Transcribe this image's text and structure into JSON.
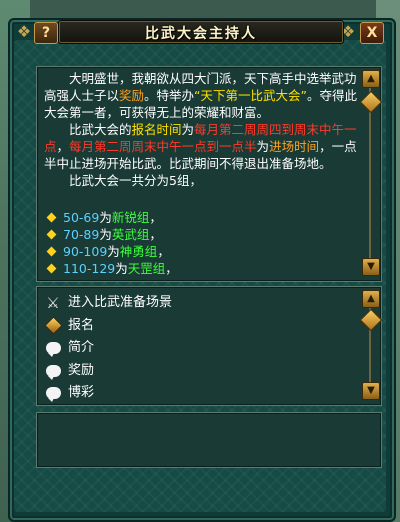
{
  "window": {
    "title": "比武大会主持人",
    "help_label": "?",
    "close_label": "X"
  },
  "dialog": {
    "p1_a": "大明盛世，我朝欲从四大门派，天下高手中选举武功高强人士子以",
    "p1_b": "奖励",
    "p1_c": "。特举办",
    "p1_d": "“天下第一比武大会”",
    "p1_e": "。夺得此大会第一者，可获得无上的荣耀和财富。",
    "p2_a": "比武大会的",
    "p2_b": "报名时间",
    "p2_c": "为",
    "p2_d": "每月第二周周四到周末中午一点",
    "p2_e": "，",
    "p2_f": "每月第二周周末中午一点到一点半",
    "p2_g": "为",
    "p2_h": "进场时间",
    "p2_i": "，一点半中止进场开始比武。比武期间不得退出准备场地。",
    "p3": "比武大会一共分为5组，",
    "groups": [
      {
        "range": "50-69",
        "connector": "为",
        "name": "新锐组",
        "suffix": "，"
      },
      {
        "range": "70-89",
        "connector": "为",
        "name": "英武组",
        "suffix": "，"
      },
      {
        "range": "90-109",
        "connector": "为",
        "name": "神勇组",
        "suffix": "，"
      },
      {
        "range": "110-129",
        "connector": "为",
        "name": "天罡组",
        "suffix": "，"
      }
    ]
  },
  "menu": {
    "items": [
      {
        "label": "进入比武准备场景",
        "icon": "crossed-swords-icon"
      },
      {
        "label": "报名",
        "icon": "diamond-icon"
      },
      {
        "label": "简介",
        "icon": "chat-bubble-icon"
      },
      {
        "label": "奖励",
        "icon": "chat-bubble-icon"
      },
      {
        "label": "博彩",
        "icon": "chat-bubble-icon"
      }
    ]
  },
  "colors": {
    "highlight_yellow": "#ffe100",
    "highlight_red": "#ff3a2a",
    "highlight_orange": "#ffa21e",
    "group_range": "#5ad2ff",
    "group_name": "#3dff3d",
    "panel_bg": "#1a3a35"
  }
}
